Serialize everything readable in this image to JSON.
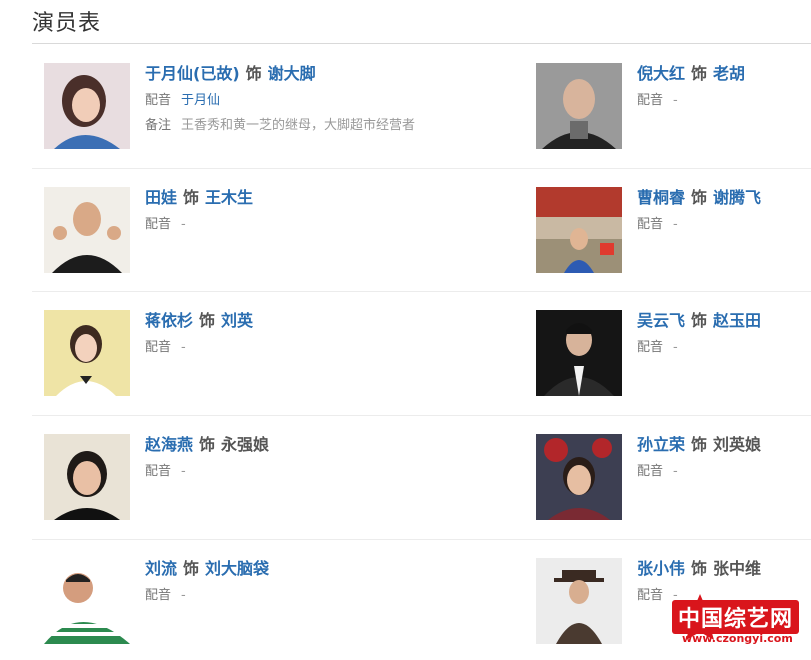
{
  "page": {
    "title": "演员表"
  },
  "cast": [
    {
      "actor": "于月仙(已故)",
      "sep": "饰",
      "role": "谢大脚",
      "role_link": true,
      "dub_label": "配音",
      "dub": "于月仙",
      "dub_link": true,
      "note_label": "备注",
      "note": "王香秀和黄一芝的继母，大脚超市经营者"
    },
    {
      "actor": "倪大红",
      "sep": "饰",
      "role": "老胡",
      "role_link": true,
      "dub_label": "配音",
      "dub": "-"
    },
    {
      "actor": "田娃",
      "sep": "饰",
      "role": "王木生",
      "role_link": true,
      "dub_label": "配音",
      "dub": "-"
    },
    {
      "actor": "曹桐睿",
      "sep": "饰",
      "role": "谢腾飞",
      "role_link": true,
      "dub_label": "配音",
      "dub": "-"
    },
    {
      "actor": "蒋依杉",
      "sep": "饰",
      "role": "刘英",
      "role_link": true,
      "dub_label": "配音",
      "dub": "-"
    },
    {
      "actor": "吴云飞",
      "sep": "饰",
      "role": "赵玉田",
      "role_link": true,
      "dub_label": "配音",
      "dub": "-"
    },
    {
      "actor": "赵海燕",
      "sep": "饰",
      "role": "永强娘",
      "role_link": false,
      "dub_label": "配音",
      "dub": "-"
    },
    {
      "actor": "孙立荣",
      "sep": "饰",
      "role": "刘英娘",
      "role_link": false,
      "dub_label": "配音",
      "dub": "-"
    },
    {
      "actor": "刘流",
      "sep": "饰",
      "role": "刘大脑袋",
      "role_link": true,
      "dub_label": "配音",
      "dub": "-"
    },
    {
      "actor": "张小伟",
      "sep": "饰",
      "role": "张中维",
      "role_link": false,
      "dub_label": "配音",
      "dub": "-"
    }
  ],
  "watermark": {
    "text": "中国综艺网",
    "url": "www.czongyi.com"
  },
  "colors": {
    "link": "#2a6db0",
    "brand_red": "#d9151c"
  }
}
